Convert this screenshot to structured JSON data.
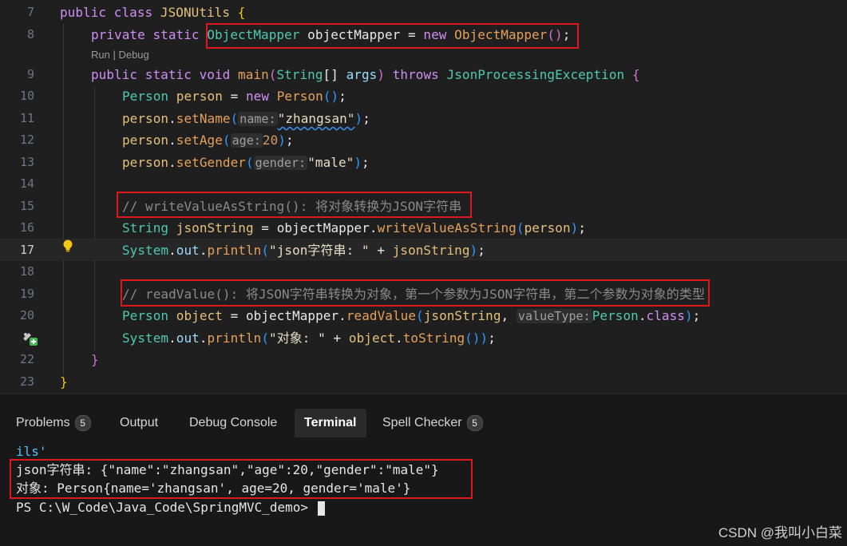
{
  "editor": {
    "codelens": "Run | Debug",
    "lines": [
      {
        "num": "7",
        "active": false
      },
      {
        "num": "8",
        "active": false
      },
      {
        "num": "9",
        "active": false
      },
      {
        "num": "10",
        "active": false
      },
      {
        "num": "11",
        "active": false
      },
      {
        "num": "12",
        "active": false
      },
      {
        "num": "13",
        "active": false
      },
      {
        "num": "14",
        "active": false
      },
      {
        "num": "15",
        "active": false
      },
      {
        "num": "16",
        "active": false
      },
      {
        "num": "17",
        "active": true
      },
      {
        "num": "18",
        "active": false
      },
      {
        "num": "19",
        "active": false
      },
      {
        "num": "20",
        "active": false
      },
      {
        "num": "22",
        "active": false
      },
      {
        "num": "23",
        "active": false
      }
    ],
    "code": {
      "l7": {
        "public": "public",
        "class": "class",
        "name": "JSONUtils",
        "brace": "{"
      },
      "l8": {
        "private": "private",
        "static": "static",
        "type": "ObjectMapper",
        "var": "objectMapper",
        "eq": " = ",
        "new": "new",
        "ctor": "ObjectMapper",
        "paren": "()",
        "semi": ";"
      },
      "l9": {
        "public": "public",
        "static": "static",
        "void": "void",
        "main": "main",
        "p1": "(",
        "strtype": "String",
        "arr": "[] ",
        "args": "args",
        "p2": ")",
        "throws": "throws",
        "exc": "JsonProcessingException",
        "brace": "{"
      },
      "l10": {
        "type": "Person",
        "var": "person",
        "eq": " = ",
        "new": "new",
        "ctor": "Person",
        "paren": "()",
        "semi": ";"
      },
      "l11": {
        "obj": "person",
        "dot": ".",
        "m": "setName",
        "p1": "(",
        "hint": "name:",
        "str": "\"zhangsan\"",
        "p2": ")",
        "semi": ";"
      },
      "l12": {
        "obj": "person",
        "dot": ".",
        "m": "setAge",
        "p1": "(",
        "hint": "age:",
        "num": "20",
        "p2": ")",
        "semi": ";"
      },
      "l13": {
        "obj": "person",
        "dot": ".",
        "m": "setGender",
        "p1": "(",
        "hint": "gender:",
        "str": "\"male\"",
        "p2": ")",
        "semi": ";"
      },
      "l15": {
        "comment": "// writeValueAsString(): 将对象转换为JSON字符串"
      },
      "l16": {
        "type": "String",
        "var": "jsonString",
        "eq": " = ",
        "obj": "objectMapper",
        "dot": ".",
        "m": "writeValueAsString",
        "p1": "(",
        "arg": "person",
        "p2": ")",
        "semi": ";"
      },
      "l17": {
        "sys": "System",
        "dot": ".",
        "out": "out",
        "dot2": ".",
        "m": "println",
        "p1": "(",
        "str": "\"json字符串: \"",
        "plus": " + ",
        "arg": "jsonString",
        "p2": ")",
        "semi": ";"
      },
      "l19": {
        "comment": "// readValue(): 将JSON字符串转换为对象，第一个参数为JSON字符串，第二个参数为对象的类型"
      },
      "l20": {
        "type": "Person",
        "var": "object",
        "eq": " = ",
        "obj": "objectMapper",
        "dot": ".",
        "m": "readValue",
        "p1": "(",
        "arg": "jsonString",
        "comma": ", ",
        "hint": "valueType:",
        "cls": "Person",
        "dot2": ".",
        "clskw": "class",
        "p2": ")",
        "semi": ";"
      },
      "l21": {
        "sys": "System",
        "dot": ".",
        "out": "out",
        "dot2": ".",
        "m": "println",
        "p1": "(",
        "str": "\"对象: \"",
        "plus": " + ",
        "arg": "object",
        "dot3": ".",
        "m2": "toString",
        "p2": "())",
        "semi": ";"
      },
      "l22": {
        "brace": "}"
      },
      "l23": {
        "brace": "}"
      }
    }
  },
  "panel": {
    "tabs": [
      {
        "label": "Problems",
        "badge": "5"
      },
      {
        "label": "Output"
      },
      {
        "label": "Debug Console"
      },
      {
        "label": "Terminal",
        "active": true
      },
      {
        "label": "Spell Checker",
        "badge": "5"
      }
    ]
  },
  "terminal": {
    "line0": "ils'",
    "line1": "json字符串: {\"name\":\"zhangsan\",\"age\":20,\"gender\":\"male\"}",
    "line2": "对象: Person{name='zhangsan', age=20, gender='male'}",
    "prompt": "PS C:\\W_Code\\Java_Code\\SpringMVC_demo> "
  },
  "watermark": "CSDN @我叫小白菜",
  "colors": {
    "highlight_box": "#e0171c",
    "background": "#1f1f1f"
  }
}
